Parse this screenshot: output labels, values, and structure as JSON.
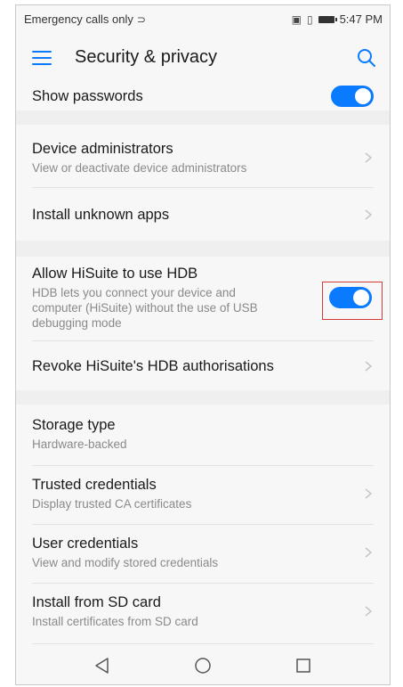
{
  "statusbar": {
    "carrier": "Emergency calls only",
    "time": "5:47 PM",
    "icons": [
      "nfc-icon",
      "vibrate-icon",
      "battery-icon"
    ]
  },
  "toolbar": {
    "title": "Security & privacy"
  },
  "items": {
    "show_passwords": {
      "title": "Show passwords",
      "toggle_on": true
    },
    "device_admins": {
      "title": "Device administrators",
      "subtitle": "View or deactivate device administrators"
    },
    "install_unknown": {
      "title": "Install unknown apps"
    },
    "hisuite_hdb": {
      "title": "Allow HiSuite to use HDB",
      "subtitle_line1": "HDB lets you connect your device and",
      "subtitle_line2": "computer (HiSuite) without the use of USB",
      "subtitle_line3": "debugging mode",
      "toggle_on": true
    },
    "revoke_hdb": {
      "title": "Revoke HiSuite's HDB authorisations"
    },
    "storage_type": {
      "title": "Storage type",
      "subtitle": "Hardware-backed"
    },
    "trusted_credentials": {
      "title": "Trusted credentials",
      "subtitle": "Display trusted CA certificates"
    },
    "user_credentials": {
      "title": "User credentials",
      "subtitle": "View and modify stored credentials"
    },
    "install_sd": {
      "title": "Install from SD card",
      "subtitle": "Install certificates from SD card"
    }
  },
  "colors": {
    "accent": "#0a7aff",
    "highlight_box": "#d23a3a"
  }
}
